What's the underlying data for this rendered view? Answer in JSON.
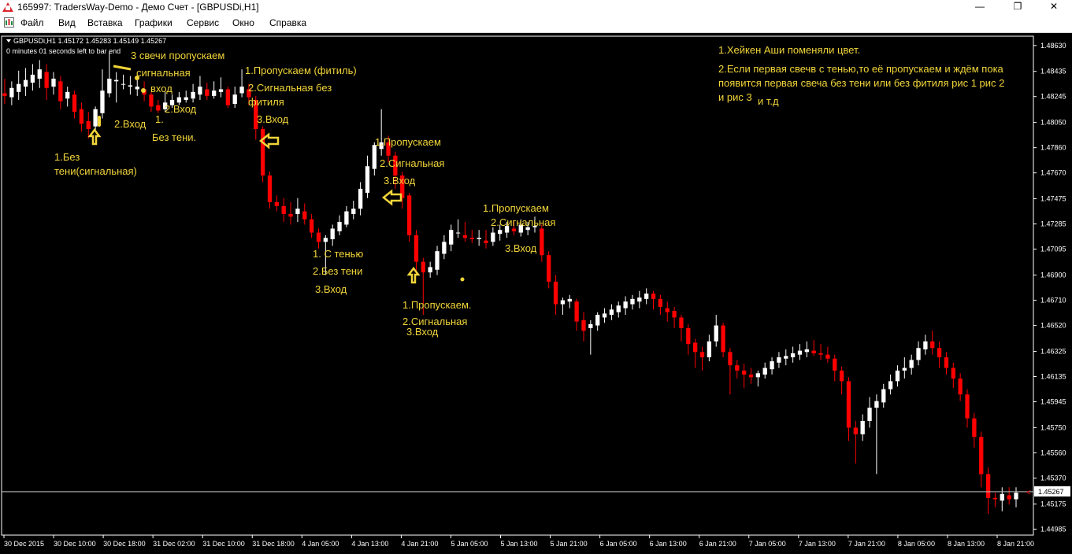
{
  "window": {
    "title": "165997: TradersWay-Demo - Демо Счет - [GBPUSDi,H1]",
    "controls": {
      "minimize": "—",
      "restore": "❐",
      "close": "✕"
    }
  },
  "menu": {
    "items": [
      "Файл",
      "Вид",
      "Вставка",
      "Графики",
      "Сервис",
      "Окно",
      "Справка"
    ]
  },
  "chart": {
    "symbol_info": "GBPUSDi,H1  1.45172 1.45283 1.45149 1.45267",
    "bar_timer": "0 minutes 01 seconds left to bar end",
    "bid_label": "1.45267",
    "colors": {
      "background": "#000000",
      "bull": "#ffffff",
      "bear": "#ff0000",
      "annotation": "#f1d53a"
    }
  },
  "chart_data": {
    "type": "candlestick",
    "subtype": "Heikin-Ashi",
    "symbol": "GBPUSDi",
    "timeframe": "H1",
    "ylim": [
      1.4494,
      1.487
    ],
    "y_ticks": [
      "1.48630",
      "1.48435",
      "1.48245",
      "1.48050",
      "1.47860",
      "1.47670",
      "1.47475",
      "1.47285",
      "1.47095",
      "1.46900",
      "1.46710",
      "1.46520",
      "1.46325",
      "1.46135",
      "1.45945",
      "1.45750",
      "1.45560",
      "1.45370",
      "1.45175",
      "1.44985"
    ],
    "x_ticks": [
      "30 Dec 2015",
      "30 Dec 10:00",
      "30 Dec 18:00",
      "31 Dec 02:00",
      "31 Dec 10:00",
      "31 Dec 18:00",
      "4 Jan 05:00",
      "4 Jan 13:00",
      "4 Jan 21:00",
      "5 Jan 05:00",
      "5 Jan 13:00",
      "5 Jan 21:00",
      "6 Jan 05:00",
      "6 Jan 13:00",
      "6 Jan 21:00",
      "7 Jan 05:00",
      "7 Jan 13:00",
      "7 Jan 21:00",
      "8 Jan 05:00",
      "8 Jan 13:00",
      "8 Jan 21:00"
    ],
    "current_price": 1.45267,
    "ohlc": [
      [
        1.4827,
        1.4838,
        1.4819,
        1.4825
      ],
      [
        1.4824,
        1.4836,
        1.4818,
        1.4831
      ],
      [
        1.4828,
        1.4844,
        1.4822,
        1.4834
      ],
      [
        1.4832,
        1.4846,
        1.4825,
        1.4837
      ],
      [
        1.4835,
        1.4849,
        1.4829,
        1.4841
      ],
      [
        1.4838,
        1.4852,
        1.4831,
        1.4845
      ],
      [
        1.4843,
        1.4849,
        1.4822,
        1.4831
      ],
      [
        1.4832,
        1.4843,
        1.4826,
        1.4838
      ],
      [
        1.4836,
        1.484,
        1.4815,
        1.4821
      ],
      [
        1.4823,
        1.4832,
        1.4817,
        1.4828
      ],
      [
        1.4826,
        1.4829,
        1.4808,
        1.4813
      ],
      [
        1.4815,
        1.482,
        1.4798,
        1.4804
      ],
      [
        1.4806,
        1.4813,
        1.4793,
        1.48
      ],
      [
        1.4802,
        1.4817,
        1.4798,
        1.4815
      ],
      [
        1.4812,
        1.4845,
        1.4808,
        1.4829
      ],
      [
        1.4827,
        1.4858,
        1.4824,
        1.4838
      ],
      [
        1.4836,
        1.4843,
        1.482,
        1.4837
      ],
      [
        1.4834,
        1.4841,
        1.483,
        1.4834
      ],
      [
        1.4832,
        1.484,
        1.4826,
        1.4833
      ],
      [
        1.483,
        1.4837,
        1.4825,
        1.4832
      ],
      [
        1.483,
        1.4836,
        1.4821,
        1.4826
      ],
      [
        1.4826,
        1.4828,
        1.4813,
        1.4817
      ],
      [
        1.4818,
        1.4822,
        1.4812,
        1.4814
      ],
      [
        1.4815,
        1.4828,
        1.4813,
        1.482
      ],
      [
        1.4818,
        1.4826,
        1.4816,
        1.4822
      ],
      [
        1.482,
        1.4828,
        1.4818,
        1.4824
      ],
      [
        1.4822,
        1.4829,
        1.482,
        1.4824
      ],
      [
        1.4823,
        1.4834,
        1.482,
        1.4828
      ],
      [
        1.4826,
        1.484,
        1.4822,
        1.4832
      ],
      [
        1.483,
        1.4835,
        1.4822,
        1.4825
      ],
      [
        1.4825,
        1.4836,
        1.4823,
        1.4829
      ],
      [
        1.4828,
        1.4839,
        1.4824,
        1.483
      ],
      [
        1.483,
        1.4832,
        1.4816,
        1.4818
      ],
      [
        1.4819,
        1.4832,
        1.4816,
        1.4826
      ],
      [
        1.4827,
        1.4845,
        1.4824,
        1.4832
      ],
      [
        1.483,
        1.4834,
        1.4818,
        1.4824
      ],
      [
        1.4822,
        1.4825,
        1.4792,
        1.48
      ],
      [
        1.48,
        1.4802,
        1.476,
        1.4765
      ],
      [
        1.4765,
        1.4768,
        1.474,
        1.4745
      ],
      [
        1.4745,
        1.475,
        1.4738,
        1.4742
      ],
      [
        1.4742,
        1.4748,
        1.473,
        1.4736
      ],
      [
        1.4736,
        1.4745,
        1.4728,
        1.4734
      ],
      [
        1.4736,
        1.4748,
        1.473,
        1.474
      ],
      [
        1.4738,
        1.4744,
        1.4728,
        1.4732
      ],
      [
        1.4732,
        1.4736,
        1.4718,
        1.4722
      ],
      [
        1.4722,
        1.4725,
        1.471,
        1.4715
      ],
      [
        1.4715,
        1.472,
        1.469,
        1.4718
      ],
      [
        1.4717,
        1.4728,
        1.4712,
        1.4725
      ],
      [
        1.4723,
        1.4735,
        1.472,
        1.473
      ],
      [
        1.4728,
        1.4742,
        1.4726,
        1.4738
      ],
      [
        1.4736,
        1.4746,
        1.4732,
        1.474
      ],
      [
        1.474,
        1.476,
        1.4735,
        1.4755
      ],
      [
        1.4752,
        1.478,
        1.4748,
        1.4772
      ],
      [
        1.477,
        1.479,
        1.4765,
        1.4788
      ],
      [
        1.4785,
        1.4815,
        1.478,
        1.479
      ],
      [
        1.479,
        1.4795,
        1.4775,
        1.478
      ],
      [
        1.478,
        1.4783,
        1.4755,
        1.4765
      ],
      [
        1.4765,
        1.4768,
        1.474,
        1.4748
      ],
      [
        1.475,
        1.4752,
        1.4715,
        1.472
      ],
      [
        1.472,
        1.4724,
        1.469,
        1.47
      ],
      [
        1.47,
        1.4703,
        1.466,
        1.4692
      ],
      [
        1.4692,
        1.47,
        1.4688,
        1.4696
      ],
      [
        1.4694,
        1.4712,
        1.469,
        1.4708
      ],
      [
        1.4706,
        1.472,
        1.4702,
        1.4715
      ],
      [
        1.4713,
        1.4728,
        1.4708,
        1.4724
      ],
      [
        1.4722,
        1.4732,
        1.4718,
        1.4722
      ],
      [
        1.472,
        1.473,
        1.4715,
        1.4718
      ],
      [
        1.4718,
        1.4724,
        1.4714,
        1.4717
      ],
      [
        1.4717,
        1.4724,
        1.4712,
        1.4718
      ],
      [
        1.4716,
        1.4724,
        1.471,
        1.4714
      ],
      [
        1.4715,
        1.4726,
        1.4712,
        1.4722
      ],
      [
        1.4721,
        1.4728,
        1.4716,
        1.4724
      ],
      [
        1.4722,
        1.473,
        1.4718,
        1.4727
      ],
      [
        1.4725,
        1.4731,
        1.472,
        1.4723
      ],
      [
        1.4722,
        1.4732,
        1.4719,
        1.4728
      ],
      [
        1.4724,
        1.473,
        1.472,
        1.4726
      ],
      [
        1.4726,
        1.4734,
        1.4722,
        1.4727
      ],
      [
        1.4725,
        1.4728,
        1.47,
        1.4705
      ],
      [
        1.4705,
        1.4708,
        1.468,
        1.4685
      ],
      [
        1.4685,
        1.469,
        1.466,
        1.4668
      ],
      [
        1.4668,
        1.4673,
        1.466,
        1.4671
      ],
      [
        1.467,
        1.4675,
        1.4665,
        1.4672
      ],
      [
        1.467,
        1.4672,
        1.4648,
        1.4655
      ],
      [
        1.4656,
        1.4662,
        1.464,
        1.4648
      ],
      [
        1.465,
        1.4656,
        1.463,
        1.4653
      ],
      [
        1.4652,
        1.4662,
        1.4648,
        1.466
      ],
      [
        1.4658,
        1.4665,
        1.4654,
        1.4661
      ],
      [
        1.466,
        1.4668,
        1.4656,
        1.4664
      ],
      [
        1.4662,
        1.467,
        1.4658,
        1.4667
      ],
      [
        1.4665,
        1.4674,
        1.466,
        1.467
      ],
      [
        1.4668,
        1.4675,
        1.4664,
        1.4672
      ],
      [
        1.467,
        1.4678,
        1.4665,
        1.4673
      ],
      [
        1.4672,
        1.468,
        1.4668,
        1.4676
      ],
      [
        1.4676,
        1.4678,
        1.4664,
        1.4672
      ],
      [
        1.4672,
        1.4675,
        1.466,
        1.4666
      ],
      [
        1.4665,
        1.467,
        1.4655,
        1.4662
      ],
      [
        1.4663,
        1.4666,
        1.465,
        1.4658
      ],
      [
        1.4658,
        1.466,
        1.464,
        1.465
      ],
      [
        1.465,
        1.4653,
        1.463,
        1.4638
      ],
      [
        1.4639,
        1.4642,
        1.462,
        1.4632
      ],
      [
        1.4632,
        1.4636,
        1.4618,
        1.4628
      ],
      [
        1.4628,
        1.4645,
        1.4625,
        1.464
      ],
      [
        1.464,
        1.466,
        1.4636,
        1.4652
      ],
      [
        1.4652,
        1.4654,
        1.4628,
        1.4632
      ],
      [
        1.4632,
        1.4635,
        1.46,
        1.4622
      ],
      [
        1.4622,
        1.4626,
        1.4612,
        1.4618
      ],
      [
        1.4618,
        1.4623,
        1.4605,
        1.4615
      ],
      [
        1.4615,
        1.462,
        1.4608,
        1.4613
      ],
      [
        1.4613,
        1.4618,
        1.4606,
        1.4616
      ],
      [
        1.4615,
        1.4624,
        1.4612,
        1.462
      ],
      [
        1.4619,
        1.4628,
        1.4615,
        1.4625
      ],
      [
        1.4624,
        1.4632,
        1.462,
        1.4628
      ],
      [
        1.4627,
        1.4634,
        1.4622,
        1.4629
      ],
      [
        1.4628,
        1.4636,
        1.4624,
        1.4631
      ],
      [
        1.463,
        1.4638,
        1.4626,
        1.4633
      ],
      [
        1.4632,
        1.464,
        1.4628,
        1.4634
      ],
      [
        1.4633,
        1.4641,
        1.4629,
        1.4631
      ],
      [
        1.4631,
        1.4638,
        1.4626,
        1.463
      ],
      [
        1.463,
        1.4636,
        1.4624,
        1.4627
      ],
      [
        1.4627,
        1.463,
        1.461,
        1.4618
      ],
      [
        1.4618,
        1.4621,
        1.46,
        1.461
      ],
      [
        1.461,
        1.4613,
        1.4565,
        1.4575
      ],
      [
        1.4575,
        1.458,
        1.4548,
        1.457
      ],
      [
        1.457,
        1.4585,
        1.4565,
        1.458
      ],
      [
        1.458,
        1.4598,
        1.4575,
        1.459
      ],
      [
        1.459,
        1.46,
        1.454,
        1.4595
      ],
      [
        1.4594,
        1.4608,
        1.459,
        1.4604
      ],
      [
        1.4604,
        1.4615,
        1.46,
        1.461
      ],
      [
        1.461,
        1.4622,
        1.4606,
        1.4618
      ],
      [
        1.4618,
        1.4628,
        1.4612,
        1.462
      ],
      [
        1.462,
        1.463,
        1.4615,
        1.4626
      ],
      [
        1.4626,
        1.464,
        1.4622,
        1.4635
      ],
      [
        1.4634,
        1.4645,
        1.463,
        1.464
      ],
      [
        1.464,
        1.4648,
        1.463,
        1.4635
      ],
      [
        1.4635,
        1.464,
        1.462,
        1.4628
      ],
      [
        1.4628,
        1.4632,
        1.4615,
        1.462
      ],
      [
        1.462,
        1.4624,
        1.4605,
        1.4612
      ],
      [
        1.4612,
        1.4616,
        1.4595,
        1.46
      ],
      [
        1.46,
        1.4604,
        1.4575,
        1.4582
      ],
      [
        1.4582,
        1.4586,
        1.456,
        1.4568
      ],
      [
        1.4568,
        1.4572,
        1.453,
        1.454
      ],
      [
        1.454,
        1.4545,
        1.451,
        1.4522
      ],
      [
        1.4522,
        1.4526,
        1.4515,
        1.4521
      ],
      [
        1.452,
        1.453,
        1.4512,
        1.4525
      ],
      [
        1.4524,
        1.453,
        1.4517,
        1.4521
      ],
      [
        1.4521,
        1.453,
        1.4515,
        1.4526
      ]
    ],
    "annotations": [
      "3 свечи пропускаем",
      "сигнальная",
      "вход",
      "2.Вход",
      "1.",
      "Без тени.",
      "2.Вход",
      "1.Без",
      "тени(сигнальная)",
      "1.Пропускаем (фитиль)",
      "2.Сигнальная без",
      "фитиля",
      "3.Вход",
      "1.Пропускаем",
      "2.Сигнальная",
      "3.Вход",
      "1. С тенью",
      "2.Без тени",
      "3.Вход",
      "1.Пропускаем.",
      "2.Сигнальная",
      "3.Вход",
      "1.Пропускаем",
      "2.Сигнальная",
      "3.Вход",
      "1.Хейкен Аши поменяли цвет.",
      "2.Если первая свечв с тенью,то её пропускаем и ждём пока",
      "появится первая свеча без тени или без фитиля рис 1 рис 2",
      "и рис 3",
      "и т.д"
    ]
  }
}
